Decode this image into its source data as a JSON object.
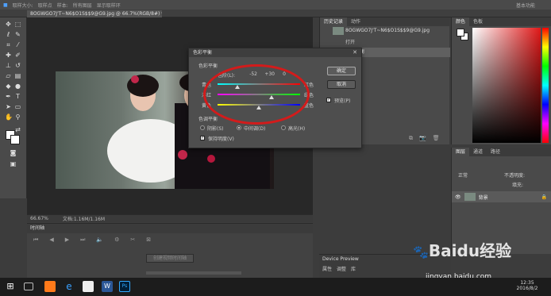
{
  "menu": {
    "items": [
      "文件",
      "取样大小:",
      "取样点",
      "样本:",
      "所有图层",
      "显示取样环"
    ],
    "workspace": "基本功能"
  },
  "document": {
    "tab_title": "8OGWGO7J'T~N6$O1S$$9@G9.jpg @ 66.7%(RGB/8#) *",
    "zoom": "66.67%",
    "doc_info": "文档:1.16M/1.16M"
  },
  "timeline": {
    "title": "时间轴",
    "create_button": "创建视频时间轴"
  },
  "history": {
    "tabs": [
      "历史记录",
      "动作"
    ],
    "snapshot_name": "8OGWGO7J'T~N6$O1S$$9@G9.jpg",
    "steps": [
      "打开",
      "色彩平衡"
    ]
  },
  "color_panel": {
    "tabs": [
      "颜色",
      "色板"
    ],
    "picked_color": "#e01818"
  },
  "layers": {
    "tabs": [
      "图层",
      "通道",
      "路径"
    ],
    "blend_mode": "正常",
    "opacity_label": "不透明度:",
    "fill_label": "填充:",
    "layer_name": "背景"
  },
  "device_preview": {
    "title": "Device Preview",
    "tabs": [
      "属性",
      "调整",
      "库"
    ]
  },
  "dialog": {
    "title": "色彩平衡",
    "section_balance": "色彩平衡",
    "levels_label": "色阶(L):",
    "levels": [
      "-52",
      "+30",
      "0"
    ],
    "sliders": [
      {
        "left": "青色",
        "right": "红色",
        "value": -52,
        "color_left": "#00ffff",
        "color_right": "#ff0000"
      },
      {
        "left": "洋红",
        "right": "绿色",
        "value": 30,
        "color_left": "#ff00ff",
        "color_right": "#00ff00"
      },
      {
        "left": "黄色",
        "right": "蓝色",
        "value": 0,
        "color_left": "#ffff00",
        "color_right": "#0000ff"
      }
    ],
    "section_tone": "色调平衡",
    "tones": [
      "阴影(S)",
      "中间调(D)",
      "高光(H)"
    ],
    "selected_tone": 1,
    "preserve_luminosity": "保持明度(V)",
    "ok": "确定",
    "cancel": "取消",
    "preview": "预览(P)"
  },
  "taskbar": {
    "time": "12:35",
    "date": "2016/8/2"
  },
  "watermark": {
    "brand": "Baidu经验",
    "url": "jingyan.baidu.com"
  }
}
